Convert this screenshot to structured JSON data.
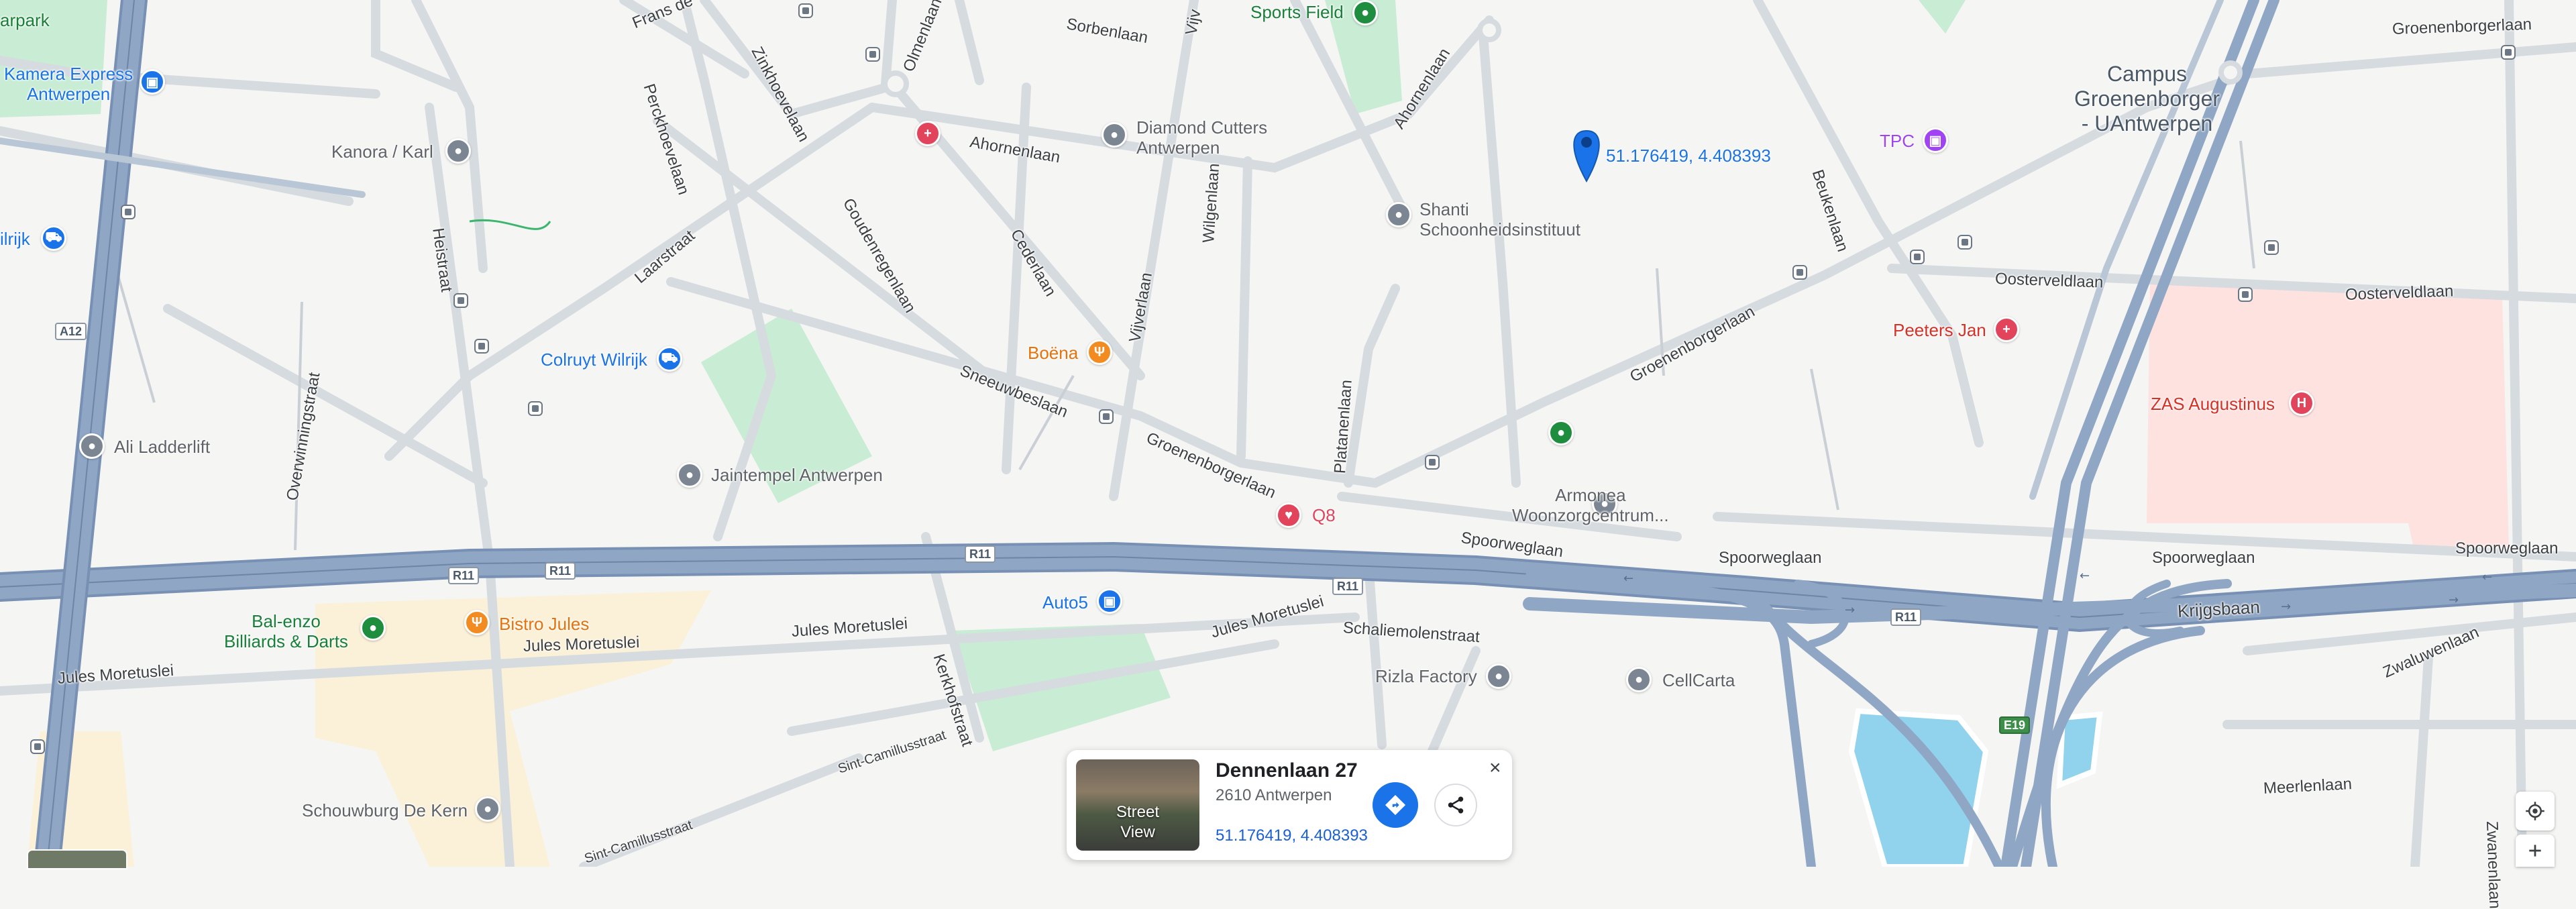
{
  "map": {
    "pin_coordinates_label": "51.176419, 4.408393",
    "places": {
      "sports_field": "Sports Field",
      "kamera_express": "Kamera Express\nAntwerpen",
      "kanora": "Kanora / Karl",
      "wilrijk": "ilrijk",
      "diamond_cutters": "Diamond Cutters\nAntwerpen",
      "shanti": "Shanti\nSchoonheidsinstituut",
      "tpc": "TPC",
      "campus": "Campus\nGroenenborger\n- UAntwerpen",
      "peeters_jan": "Peeters Jan",
      "zas": "ZAS Augustinus",
      "boena": "Boëna",
      "colruyt": "Colruyt Wilrijk",
      "ali": "Ali Ladderlift",
      "jaintempel": "Jaintempel Antwerpen",
      "armonea": "Armonea\nWoonzorgcentrum...",
      "q8": "Q8",
      "auto5": "Auto5",
      "bal_enzo": "Bal-enzo\nBilliards & Darts",
      "bistro_jules": "Bistro Jules",
      "rizla": "Rizla Factory",
      "cellcarta": "CellCarta",
      "schouwburg": "Schouwburg De Kern",
      "park_partial": "arpark"
    },
    "streets": {
      "frans": "Frans de",
      "olmenlaan": "Olmenlaan",
      "sorbenlaan": "Sorbenlaan",
      "vijv": "Vijv",
      "groenenborgerlaan_ne": "Groenenborgerlaan",
      "zinkhoevelaan": "Zinkhoevelaan",
      "perckhoevelaan": "Perckhoevelaan",
      "ahornenlaan_w": "Ahornenlaan",
      "ahornenlaan_e": "Ahornenlaan",
      "heistraat": "Heistraat",
      "goudenregenlaan": "Goudenregenlaan",
      "cederlaan": "Cederlaan",
      "wilgenlaan": "Wilgenlaan",
      "beukenlaan": "Beukenlaan",
      "oosterveldlaan_1": "Oosterveldlaan",
      "oosterveldlaan_2": "Oosterveldlaan",
      "laarstraat": "Laarstraat",
      "vijverlaan": "Vijverlaan",
      "groenenborgerlaan_mid": "Groenenborgerlaan",
      "groenenborgerlaan_sw": "Groenenborgerlaan",
      "sneeuwbeslaan": "Sneeuwbeslaan",
      "platanenlaan": "Platanenlaan",
      "overwinningstraat": "Overwinningstraat",
      "spoorweglaan_w": "Spoorweglaan",
      "spoorweglaan_m": "Spoorweglaan",
      "spoorweglaan_e": "Spoorweglaan",
      "krijgsbaan": "Krijgsbaan",
      "jules_moretuslei_1": "Jules Moretuslei",
      "jules_moretuslei_2": "Jules Moretuslei",
      "jules_moretuslei_3": "Jules Moretuslei",
      "jules_moretuslei_4": "Jules Moretuslei",
      "schaliemolenstraat": "Schaliemolenstraat",
      "kerkhofstraat": "Kerkhofstraat",
      "sint_camillus_1": "Sint-Camillusstraat",
      "sint_camillus_2": "Sint-Camillusstraat",
      "zwaluwenlaan": "Zwaluwenlaan",
      "meerlenlaan": "Meerlenlaan",
      "zwanenlaan": "Zwanenlaan"
    },
    "road_shields": [
      "A12",
      "R11",
      "R11",
      "R11",
      "R11",
      "R11",
      "E19"
    ]
  },
  "card": {
    "title": "Dennenlaan 27",
    "subtitle": "2610 Antwerpen",
    "coordinates": "51.176419, 4.408393",
    "street_view_label": "Street\nView",
    "close_label": "×"
  },
  "colors": {
    "highway": "#8fa6c4",
    "pin": "#1a73e8",
    "park": "#c9ecd4",
    "hospital": "#fde2e0"
  },
  "icons": [
    "location-pin-icon",
    "directions-icon",
    "share-icon",
    "close-icon",
    "my-location-icon",
    "zoom-in-icon"
  ]
}
